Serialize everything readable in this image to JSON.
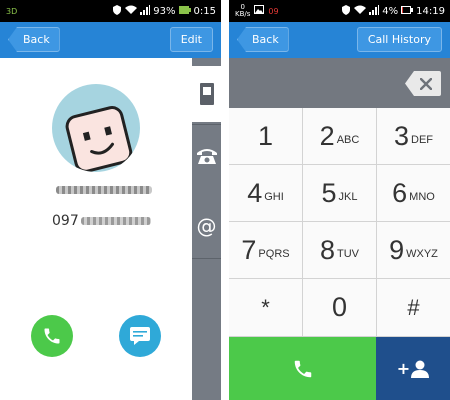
{
  "left_screen": {
    "status_bar": {
      "left_badge": "3D",
      "battery": "93%",
      "time": "0:15"
    },
    "app_bar": {
      "back_label": "Back",
      "edit_label": "Edit"
    },
    "contact": {
      "phone_prefix": "097"
    },
    "side_tabs": [
      "phone-info-icon",
      "telephone-icon",
      "at-sign-icon"
    ]
  },
  "right_screen": {
    "status_bar": {
      "net_rate_top": "0",
      "net_rate_bottom": "KB/s",
      "alert": "09",
      "battery": "4%",
      "time": "14:19"
    },
    "app_bar": {
      "back_label": "Back",
      "history_label": "Call History"
    },
    "keypad": [
      {
        "digit": "1",
        "letters": ""
      },
      {
        "digit": "2",
        "letters": "ABC"
      },
      {
        "digit": "3",
        "letters": "DEF"
      },
      {
        "digit": "4",
        "letters": "GHI"
      },
      {
        "digit": "5",
        "letters": "JKL"
      },
      {
        "digit": "6",
        "letters": "MNO"
      },
      {
        "digit": "7",
        "letters": "PQRS"
      },
      {
        "digit": "8",
        "letters": "TUV"
      },
      {
        "digit": "9",
        "letters": "WXYZ"
      },
      {
        "digit": "*",
        "letters": ""
      },
      {
        "digit": "0",
        "letters": ""
      },
      {
        "digit": "#",
        "letters": ""
      }
    ],
    "add_contact_plus": "+"
  },
  "colors": {
    "app_bar": "#2684d6",
    "call_green": "#4cc94a",
    "message_blue": "#2fa9d8",
    "add_contact_navy": "#1f4f8c",
    "side_tab_gray": "#757b84"
  }
}
